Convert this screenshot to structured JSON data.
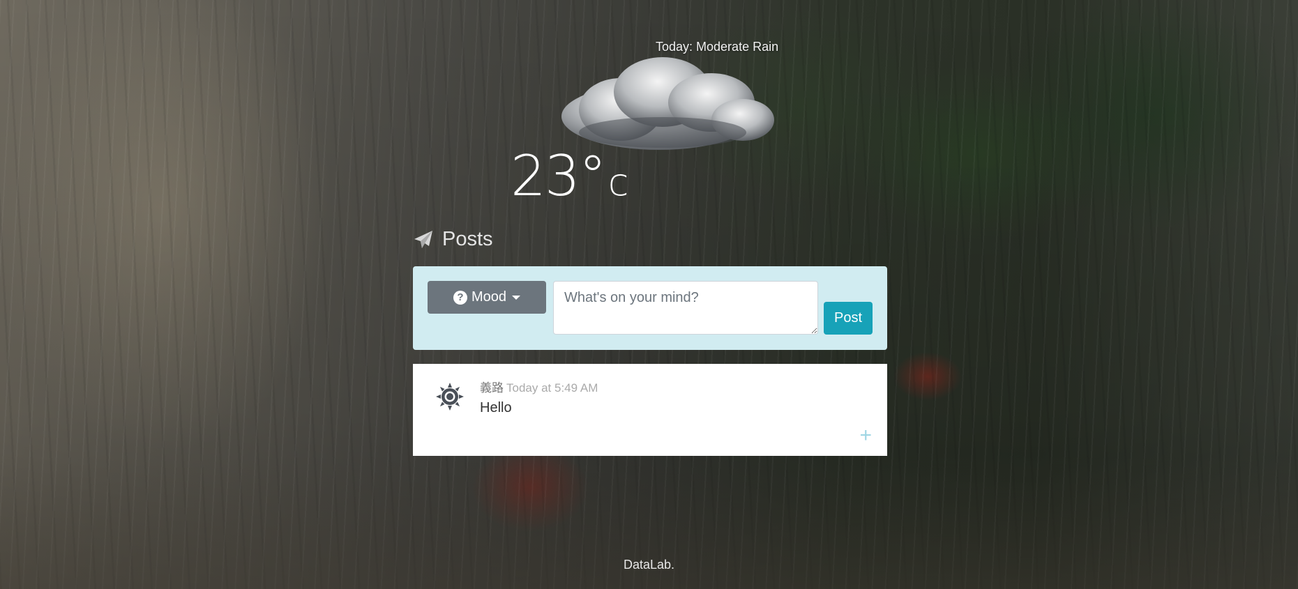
{
  "weather": {
    "title": "Today: Moderate Rain",
    "icon": "rain-cloud-icon",
    "temperature": "23°",
    "unit": "c"
  },
  "posts": {
    "title": "Posts",
    "icon": "paper-plane-icon"
  },
  "composer": {
    "mood_label": "Mood",
    "mood_icon": "question-circle-icon",
    "input_placeholder": "What's on your mind?",
    "input_value": "",
    "post_label": "Post"
  },
  "feed": [
    {
      "author": "義路",
      "time": "Today at 5:49 AM",
      "body": "Hello",
      "mood_icon": "sun-icon",
      "expand_label": "+"
    }
  ],
  "footer": {
    "text": "DataLab."
  },
  "colors": {
    "composer_bg": "#d1ecf1",
    "mood_button": "#6c757d",
    "post_button": "#17a2b8",
    "expand_icon": "#9fd6e4"
  }
}
